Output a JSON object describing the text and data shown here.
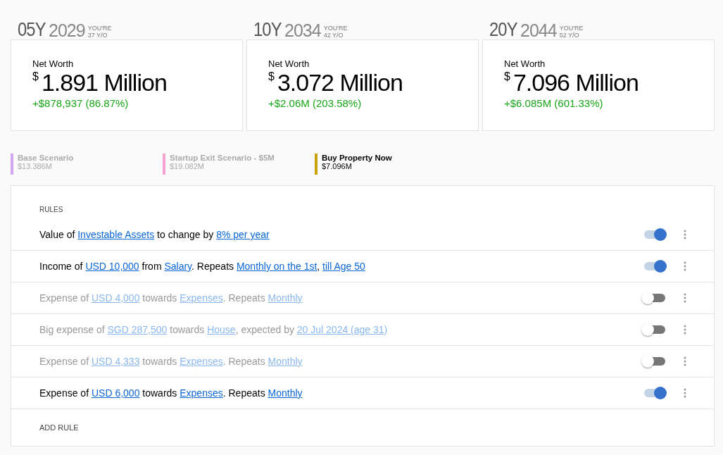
{
  "projections": [
    {
      "offset": "05Y",
      "year": "2029",
      "age_caption": "YOU'RE",
      "age": "37 Y/O",
      "label": "Net Worth",
      "currency": "$",
      "value": "1.891 Million",
      "change": "+$878,937 (86.87%)"
    },
    {
      "offset": "10Y",
      "year": "2034",
      "age_caption": "YOU'RE",
      "age": "42 Y/O",
      "label": "Net Worth",
      "currency": "$",
      "value": "3.072 Million",
      "change": "+$2.06M (203.58%)"
    },
    {
      "offset": "20Y",
      "year": "2044",
      "age_caption": "YOU'RE",
      "age": "52 Y/O",
      "label": "Net Worth",
      "currency": "$",
      "value": "7.096 Million",
      "change": "+$6.085M (601.33%)"
    }
  ],
  "scenarios": [
    {
      "name": "Base Scenario",
      "amount": "$13.386M",
      "color": "#d4a5f5",
      "selected": false
    },
    {
      "name": "Startup Exit Scenario - $5M",
      "amount": "$19.082M",
      "color": "#f5a3cf",
      "selected": false
    },
    {
      "name": "Buy Property Now",
      "amount": "$7.096M",
      "color": "#c9a20a",
      "selected": true
    }
  ],
  "rules": {
    "title": "RULES",
    "items": [
      {
        "on": true,
        "parts": [
          {
            "kind": "text",
            "text": "Value of "
          },
          {
            "kind": "link",
            "text": "Investable Assets"
          },
          {
            "kind": "text",
            "text": " to change by "
          },
          {
            "kind": "link",
            "text": "8% per year"
          }
        ]
      },
      {
        "on": true,
        "parts": [
          {
            "kind": "text",
            "text": "Income of "
          },
          {
            "kind": "link",
            "text": "USD 10,000"
          },
          {
            "kind": "text",
            "text": " from "
          },
          {
            "kind": "link",
            "text": "Salary"
          },
          {
            "kind": "text",
            "text": ". Repeats "
          },
          {
            "kind": "link",
            "text": "Monthly on the 1st"
          },
          {
            "kind": "text",
            "text": ", "
          },
          {
            "kind": "link",
            "text": "till Age 50"
          }
        ]
      },
      {
        "on": false,
        "parts": [
          {
            "kind": "text",
            "text": "Expense of "
          },
          {
            "kind": "link",
            "text": "USD 4,000"
          },
          {
            "kind": "text",
            "text": " towards "
          },
          {
            "kind": "link",
            "text": "Expenses"
          },
          {
            "kind": "text",
            "text": ". Repeats "
          },
          {
            "kind": "link",
            "text": "Monthly"
          }
        ]
      },
      {
        "on": false,
        "parts": [
          {
            "kind": "text",
            "text": "Big expense of "
          },
          {
            "kind": "link",
            "text": "SGD 287,500"
          },
          {
            "kind": "text",
            "text": " towards "
          },
          {
            "kind": "link",
            "text": "House"
          },
          {
            "kind": "text",
            "text": ", expected by "
          },
          {
            "kind": "link",
            "text": "20 Jul 2024 (age 31)"
          }
        ]
      },
      {
        "on": false,
        "parts": [
          {
            "kind": "text",
            "text": "Expense of "
          },
          {
            "kind": "link",
            "text": "USD 4,333"
          },
          {
            "kind": "text",
            "text": " towards "
          },
          {
            "kind": "link",
            "text": "Expenses"
          },
          {
            "kind": "text",
            "text": ". Repeats "
          },
          {
            "kind": "link",
            "text": "Monthly"
          }
        ]
      },
      {
        "on": true,
        "parts": [
          {
            "kind": "text",
            "text": "Expense of "
          },
          {
            "kind": "link",
            "text": "USD 6,000"
          },
          {
            "kind": "text",
            "text": " towards "
          },
          {
            "kind": "link",
            "text": "Expenses"
          },
          {
            "kind": "text",
            "text": ". Repeats "
          },
          {
            "kind": "link",
            "text": "Monthly"
          }
        ]
      }
    ],
    "add_label": "ADD RULE"
  }
}
